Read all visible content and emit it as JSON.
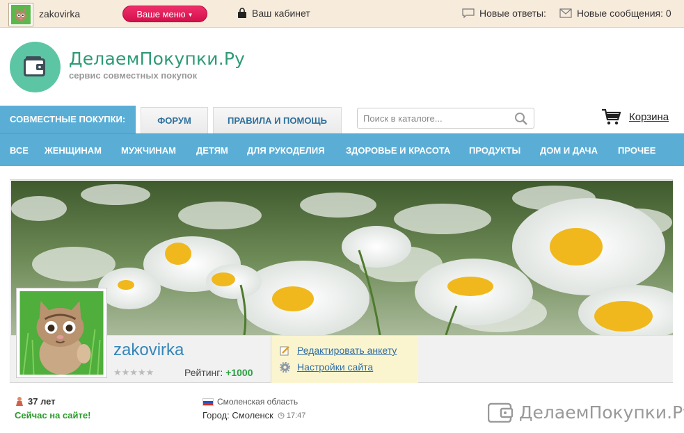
{
  "topbar": {
    "username": "zakovirka",
    "menu_label": "Ваше меню",
    "cabinet_label": "Ваш кабинет",
    "new_answers_label": "Новые ответы:",
    "new_messages_label": "Новые сообщения: 0"
  },
  "header": {
    "site_title": "ДелаемПокупки.Ру",
    "site_subtitle": "сервис совместных покупок"
  },
  "nav": {
    "main_tab": "СОВМЕСТНЫЕ ПОКУПКИ:",
    "forum_tab": "ФОРУМ",
    "rules_tab": "ПРАВИЛА И ПОМОЩЬ",
    "search_placeholder": "Поиск в каталоге...",
    "cart_label": "Корзина",
    "categories": [
      "ВСЕ",
      "ЖЕНЩИНАМ",
      "МУЖЧИНАМ",
      "ДЕТЯМ",
      "ДЛЯ РУКОДЕЛИЯ",
      "ЗДОРОВЬЕ И КРАСОТА",
      "ПРОДУКТЫ",
      "ДОМ И ДАЧА",
      "ПРОЧЕЕ"
    ]
  },
  "profile": {
    "name": "zakovirka",
    "stars": "★★★★★",
    "rating_label": "Рейтинг:",
    "rating_value": "+1000",
    "edit_profile": "Редактировать анкету",
    "site_settings": "Настройки сайта",
    "age": "37 лет",
    "online_status": "Сейчас на сайте!",
    "region": "Смоленская область",
    "city": "Город: Смоленск",
    "local_time": "17:47"
  },
  "footer": {
    "logo_text": "ДелаемПокупки.Ру"
  },
  "colors": {
    "accent_blue": "#5aaed6",
    "brand_green": "#5cc6a4",
    "menu_pink": "#e4205c",
    "link_blue": "#2f6ea6"
  }
}
